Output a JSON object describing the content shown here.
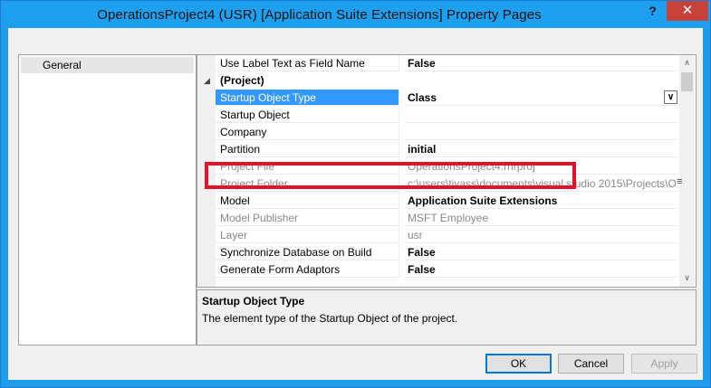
{
  "window": {
    "title": "OperationsProject4 (USR) [Application Suite Extensions] Property Pages",
    "help_label": "?",
    "close_label": "✕"
  },
  "sidebar": {
    "items": [
      {
        "label": "General"
      }
    ]
  },
  "properties": {
    "rows": [
      {
        "name": "Use Label Text as Field Name",
        "value": "False"
      },
      {
        "category": "(Project)"
      },
      {
        "name": "Startup Object Type",
        "value": "Class"
      },
      {
        "name": "Startup Object",
        "value": ""
      },
      {
        "name": "Company",
        "value": ""
      },
      {
        "name": "Partition",
        "value": "initial"
      },
      {
        "name": "Project File",
        "value": "OperationsProject4.rnrproj"
      },
      {
        "name": "Project Folder",
        "value": "c:\\users\\tivass\\documents\\visual studio 2015\\Projects\\O"
      },
      {
        "name": "Model",
        "value": "Application Suite Extensions"
      },
      {
        "name": "Model Publisher",
        "value": "MSFT Employee"
      },
      {
        "name": "Layer",
        "value": "usr"
      },
      {
        "name": "Synchronize Database on Build",
        "value": "False"
      },
      {
        "name": "Generate Form Adaptors",
        "value": "False"
      }
    ],
    "selected_row": "Startup Object Type",
    "highlighted_row": "Model",
    "dropdown_glyph": "∨",
    "collapse_glyph": "◢",
    "scroll_up_glyph": "∧",
    "scroll_down_glyph": "∨",
    "more_glyph": "≡"
  },
  "description": {
    "title": "Startup Object Type",
    "text": "The element type of the Startup Object of the project."
  },
  "buttons": {
    "ok": "OK",
    "cancel": "Cancel",
    "apply": "Apply"
  },
  "colors": {
    "titlebar": "#1ea0f0",
    "selection": "#3399ff",
    "highlight_border": "#e0132a",
    "close_button": "#c7433a"
  }
}
